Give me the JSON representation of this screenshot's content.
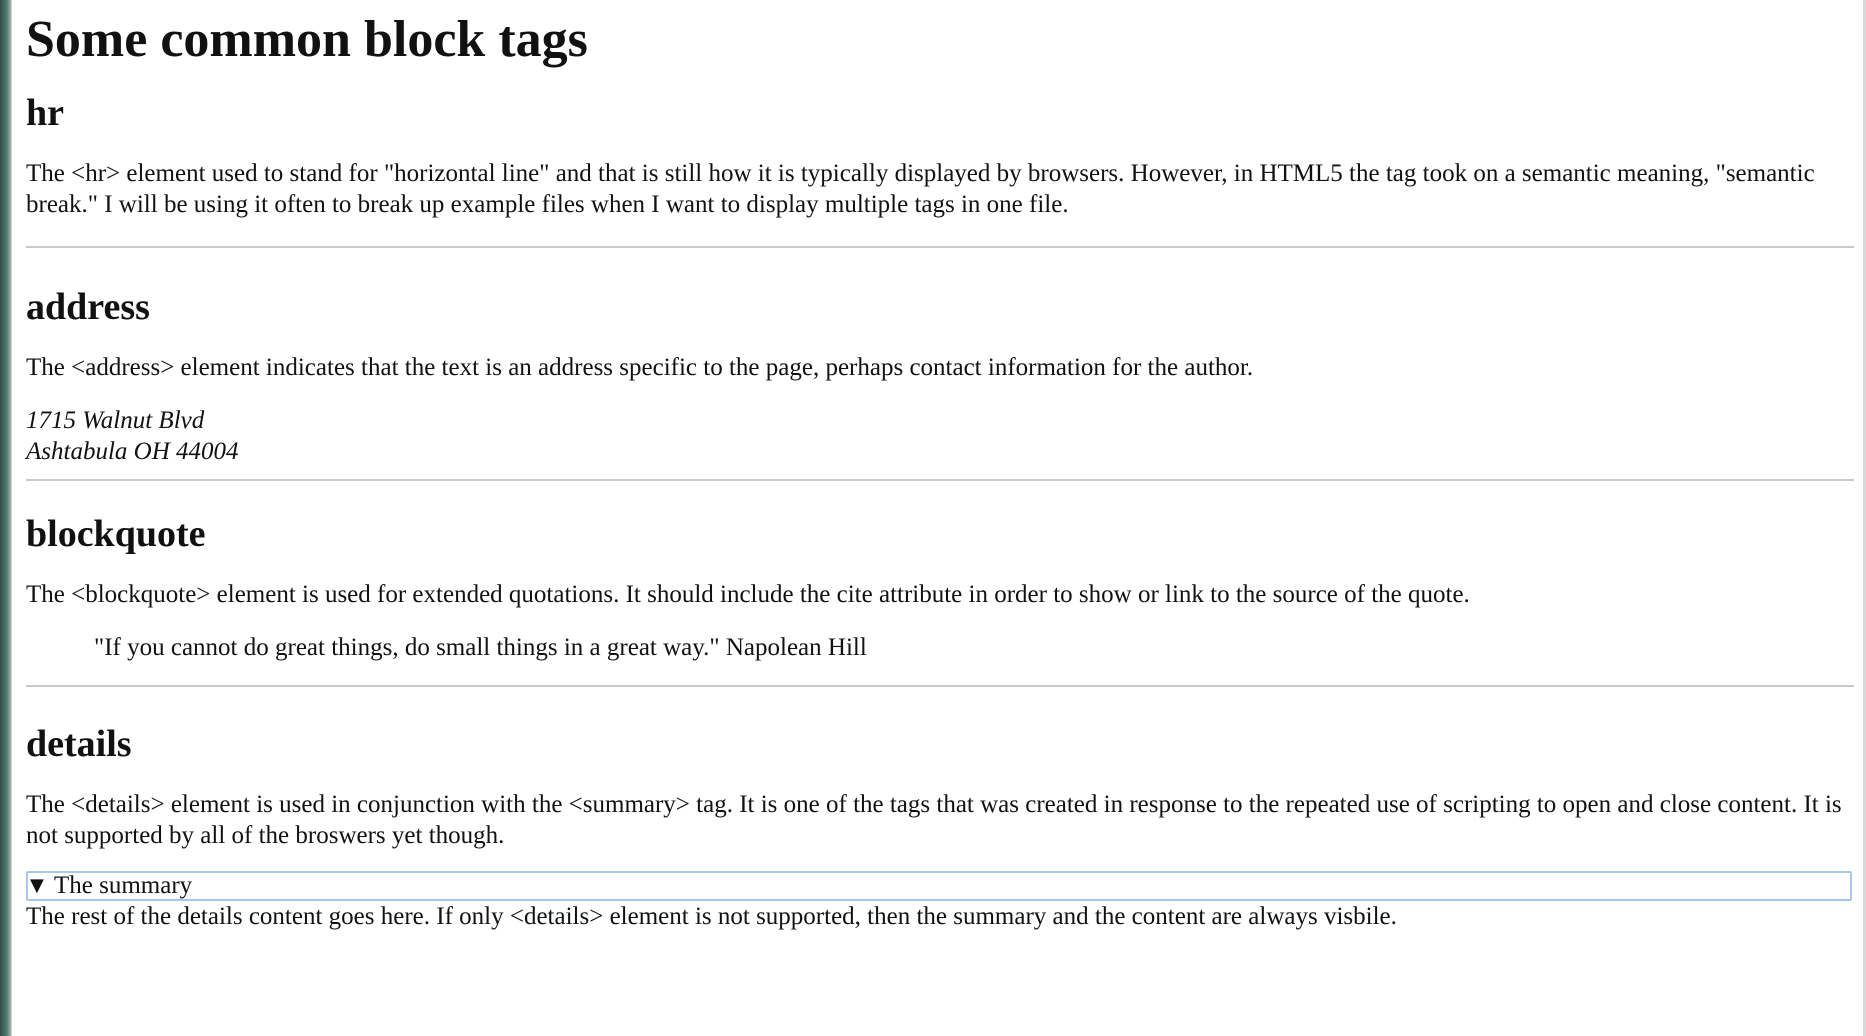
{
  "page": {
    "title": "Some common block tags"
  },
  "sections": {
    "hr": {
      "heading": "hr",
      "text": "The <hr> element used to stand for \"horizontal line\" and that is still how it is typically displayed by browsers. However, in HTML5 the tag took on a semantic meaning, \"semantic break.\" I will be using it often to break up example files when I want to display multiple tags in one file."
    },
    "address": {
      "heading": "address",
      "text": "The <address> element indicates that the text is an address specific to the page, perhaps contact information for the author.",
      "line1": "1715 Walnut Blvd",
      "line2": "Ashtabula OH 44004"
    },
    "blockquote": {
      "heading": "blockquote",
      "text": "The <blockquote> element is used for extended quotations. It should include the cite attribute in order to show or link to the source of the quote.",
      "quote": "\"If you cannot do great things, do small things in a great way.\" Napolean Hill"
    },
    "details": {
      "heading": "details",
      "text": "The <details> element is used in conjunction with the <summary> tag. It is one of the tags that was created in response to the repeated use of scripting to open and close content. It is not supported by all of the broswers yet though.",
      "summary_label": "The summary",
      "content": "The rest of the details content goes here. If only <details> element is not supported, then the summary and the content are always visbile."
    }
  },
  "icons": {
    "disclosure": "disclosure-triangle-icon"
  },
  "colors": {
    "summary_focus_border": "#a9c6ef",
    "rule": "#c9c9c9"
  }
}
